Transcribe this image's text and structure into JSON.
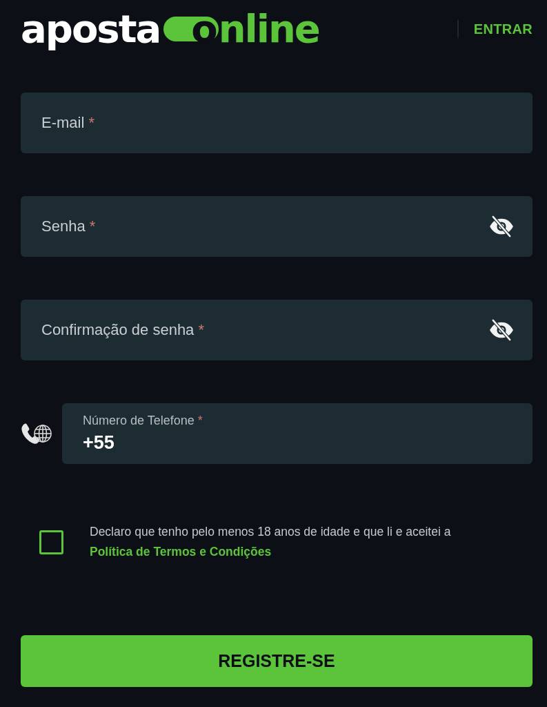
{
  "header": {
    "logo": {
      "part_1": "aposta",
      "part_2": "online"
    },
    "login_link": "ENTRAR"
  },
  "fields": [
    {
      "kind": "email",
      "label": "E-mail",
      "required_mark": "*"
    },
    {
      "kind": "password",
      "label": "Senha",
      "required_mark": "*"
    },
    {
      "kind": "password",
      "label": "Confirmação de senha",
      "required_mark": "*"
    },
    {
      "kind": "phone",
      "label": "Número de Telefone",
      "required_mark": "*",
      "value": "+55"
    }
  ],
  "terms": {
    "checked": false,
    "text": "Declaro que tenho pelo menos 18 anos de idade e que li e aceitei a",
    "link": "Política de Termos e Condições"
  },
  "submit_button": "REGISTRE-SE"
}
